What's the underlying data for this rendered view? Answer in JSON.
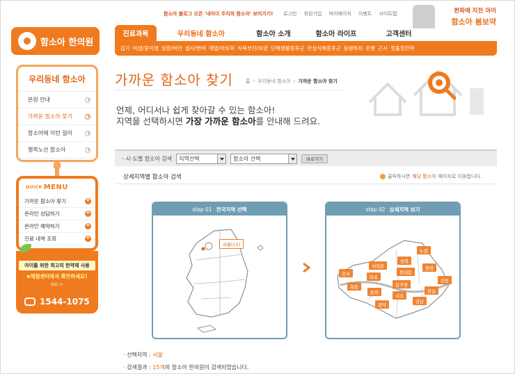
{
  "header": {
    "logo_text": "함소아 한의원",
    "banner_link": "함소아 블로그 오픈 '내아이 주치의 함소아' 보러가기!",
    "utility": [
      "로그인",
      "회원가입",
      "마이페이지",
      "이벤트",
      "사이트맵"
    ],
    "promo": {
      "line1": "한파에 지친 아이",
      "line2": "함소아 봄보약"
    }
  },
  "nav": {
    "tabs": [
      "진료과목",
      "우리동네 함소아",
      "함소아 소개",
      "함소아 라이프",
      "고객센터"
    ],
    "sub": [
      "감기",
      "비염/중이염",
      "성장/비만",
      "설사/변비",
      "태열/아토피",
      "식욕부진/보양",
      "단체생활증후군",
      "만성식체증후군",
      "동병하치",
      "운병",
      "근시",
      "첫돌첫한약"
    ]
  },
  "sidebar": {
    "title": "우리동네 함소아",
    "items": [
      "분원 안내",
      "가까운 함소아 찾기",
      "함소아에 이런 일이",
      "행복노선 함소아"
    ]
  },
  "quick": {
    "label_small": "QUICK",
    "label": "MENU",
    "items": [
      "가까운 함소아 찾기",
      "온라인 상담하기",
      "온라인 예약하기",
      "진료 내역 조회"
    ]
  },
  "ad": {
    "line1": "아이를 위한 최고의 한약재 사용",
    "line2": "e체험센터에서 확인하세요!",
    "go": "GO >",
    "phone": "1544-1075"
  },
  "page": {
    "title": "가까운 함소아 찾기",
    "breadcrumb": [
      "홈",
      "우리동네 함소아",
      "가까운 함소아 찾기"
    ],
    "intro1": "언제, 어디서나 쉽게 찾아갈 수 있는 함소아!",
    "intro2_a": "지역을 선택하시면 ",
    "intro2_b": "가장 가까운 함소아",
    "intro2_c": "를 안내해 드려요."
  },
  "search": {
    "label": "시·도별 함소아 검색",
    "region_select": "지역선택",
    "clinic_select": "함소아 선택",
    "go_button": "바로가기"
  },
  "detail": {
    "title": "상세지역별 함소아 검색",
    "tip_a": "클릭하시면 ",
    "tip_b": "해당 함소아",
    "tip_c": " 페이지로 이동합니다."
  },
  "step1": {
    "step": "step 01",
    "label": "전국지역 선택",
    "marker": "서울(15)"
  },
  "step2": {
    "step": "step 02",
    "label": "상세지역 보기",
    "districts": [
      "노원",
      "성북",
      "서대문",
      "강서",
      "마포",
      "동대문",
      "중랑",
      "목동",
      "동작",
      "압구정",
      "강동",
      "서초",
      "잠실",
      "관악",
      "강남"
    ]
  },
  "result": {
    "region_label": "· 선택지역 : ",
    "region_value": "서울",
    "count_label": "· 검색결과 : ",
    "count_value": "15개",
    "count_suffix": "의 함소아 한의원이 검색되었습니다."
  }
}
